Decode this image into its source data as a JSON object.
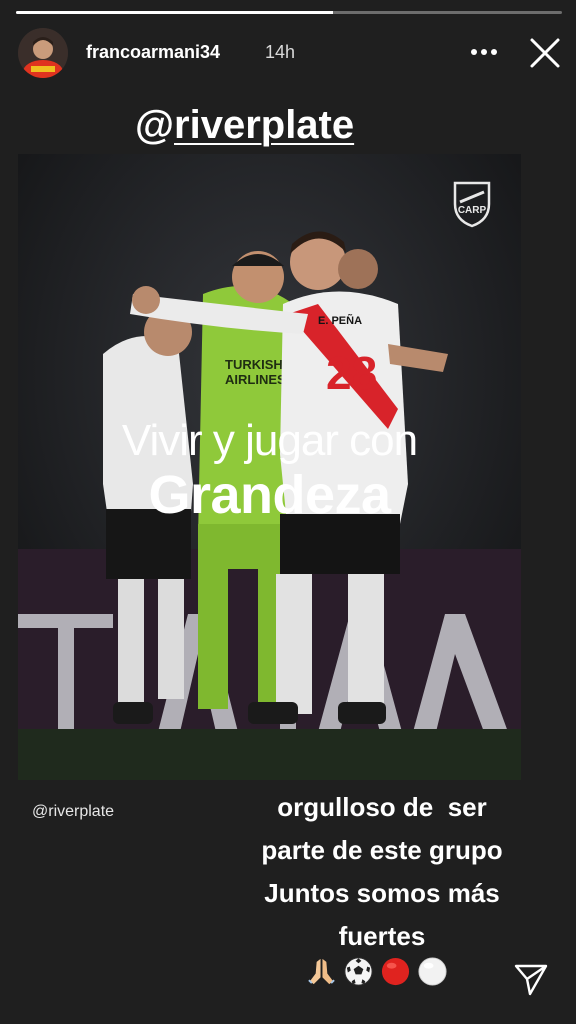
{
  "story": {
    "progress": 0.58,
    "username": "francoarmani34",
    "time_ago": "14h"
  },
  "icons": {
    "more": "more-dots-icon",
    "close": "close-icon",
    "send": "send-icon",
    "crest": "river-plate-crest-icon"
  },
  "mention_sticker": {
    "at": "@",
    "handle": "riverplate"
  },
  "image": {
    "headline_line1": "Vivir y jugar con",
    "headline_line2": "Grandeza",
    "jersey_number": "28",
    "jersey_name": "E. PEÑA",
    "sponsor_line1": "TURKISH",
    "sponsor_line2": "AIRLINES",
    "background_letters": "TALLA"
  },
  "image_mention": "@riverplate",
  "caption": {
    "line1": "orgulloso de  ser",
    "line2": "parte de este grupo",
    "line3": "Juntos somos más",
    "line4": "fuertes"
  },
  "emojis": [
    "folded-hands",
    "soccer-ball",
    "red-circle",
    "white-circle"
  ],
  "colors": {
    "background": "#1f1f1f",
    "river_red": "#d8232a",
    "goalkeeper_green": "#8fc93a",
    "text": "#ffffff"
  }
}
